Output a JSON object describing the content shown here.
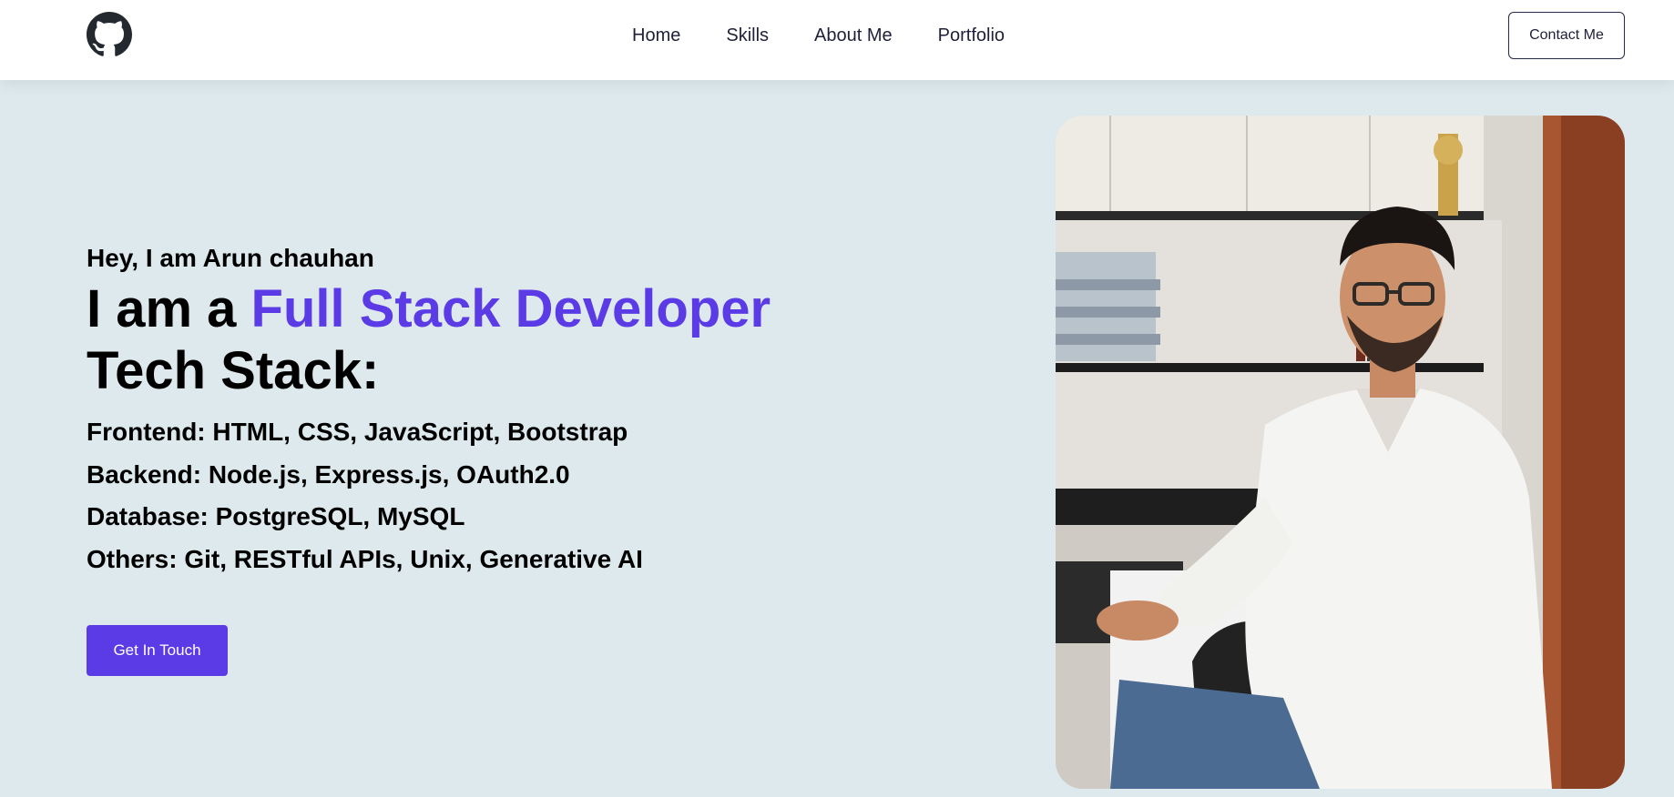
{
  "nav": {
    "logo_icon": "github-icon",
    "links": [
      "Home",
      "Skills",
      "About Me",
      "Portfolio"
    ],
    "contact_label": "Contact Me"
  },
  "hero": {
    "greeting": "Hey, I am Arun chauhan",
    "headline_prefix": "I am a ",
    "headline_accent": "Full Stack Developer",
    "stack_title": "Tech Stack:",
    "stack_lines": [
      "Frontend: HTML, CSS, JavaScript, Bootstrap",
      "Backend: Node.js, Express.js, OAuth2.0",
      "Database: PostgreSQL, MySQL",
      "Others: Git, RESTful APIs, Unix, Generative AI"
    ],
    "cta_label": "Get In Touch"
  },
  "colors": {
    "accent": "#5b3be6",
    "background": "#dde9ed",
    "nav_background": "#ffffff",
    "text": "#000000"
  }
}
